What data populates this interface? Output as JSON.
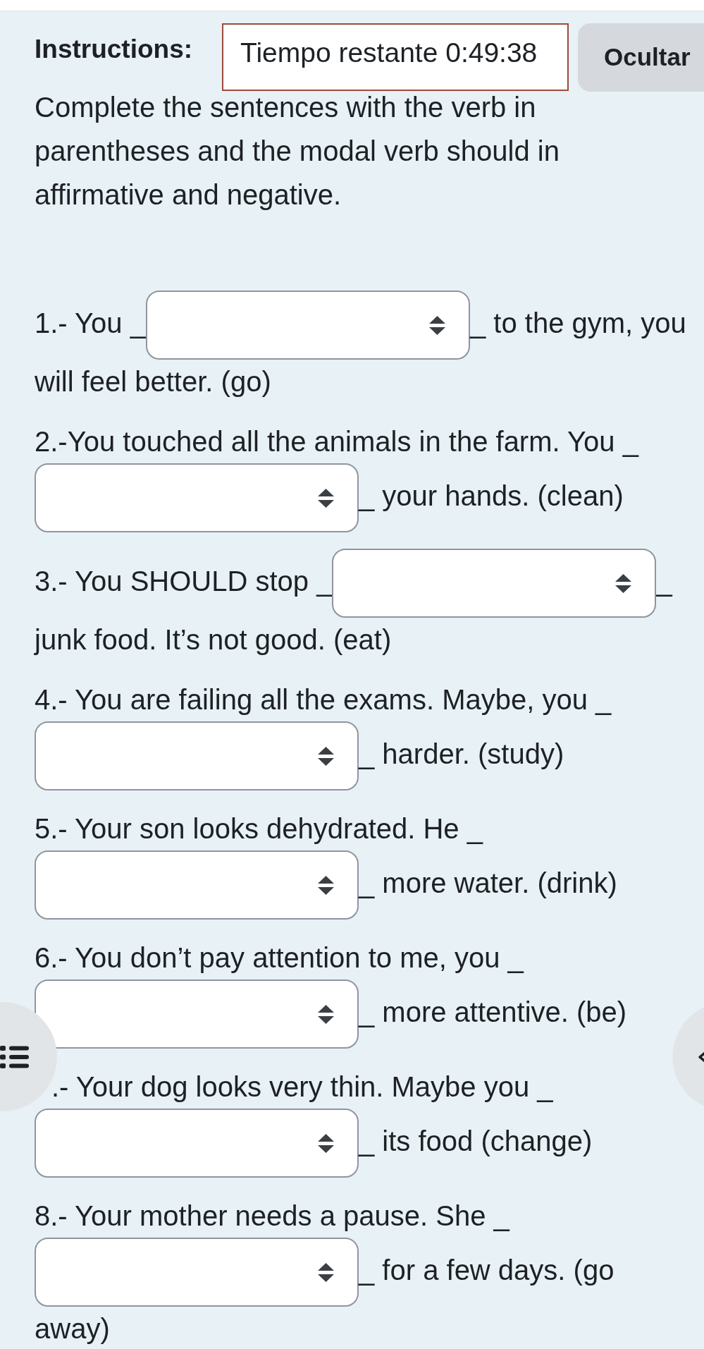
{
  "header": {
    "label": "Instructions:",
    "timer": "Tiempo restante 0:49:38",
    "hide_button": "Ocultar"
  },
  "instructions": "Complete the sentences with the verb in parentheses and the modal verb should in affirmative and negative.",
  "questions": [
    {
      "before": "1.- You _",
      "after": "_ to the gym, you",
      "continuation": "will feel better. (go)",
      "number_covered": false
    },
    {
      "before": "2.-You touched all the animals in the farm. You _",
      "after": "_ your hands. (clean)",
      "number_covered": false
    },
    {
      "before": "3.- You SHOULD stop _",
      "after": "_",
      "continuation": "junk food. It’s not good. (eat)",
      "number_covered": false
    },
    {
      "before": "4.- You are failing all the exams. Maybe, you _",
      "after": "_ harder. (study)",
      "number_covered": false
    },
    {
      "before": "5.- Your son looks dehydrated. He _",
      "after": "_ more water. (drink)",
      "number_covered": false
    },
    {
      "before": "6.- You don’t pay attention to me, you _",
      "after": "_ more attentive. (be)",
      "number_covered": false
    },
    {
      "before": ".- Your dog looks very thin. Maybe you _",
      "after": "_ its food (change)",
      "number_covered": true
    },
    {
      "before": "8.- Your mother needs a pause. She _",
      "after": "_ for a few days. (go",
      "continuation": "away)",
      "number_covered": false
    }
  ]
}
